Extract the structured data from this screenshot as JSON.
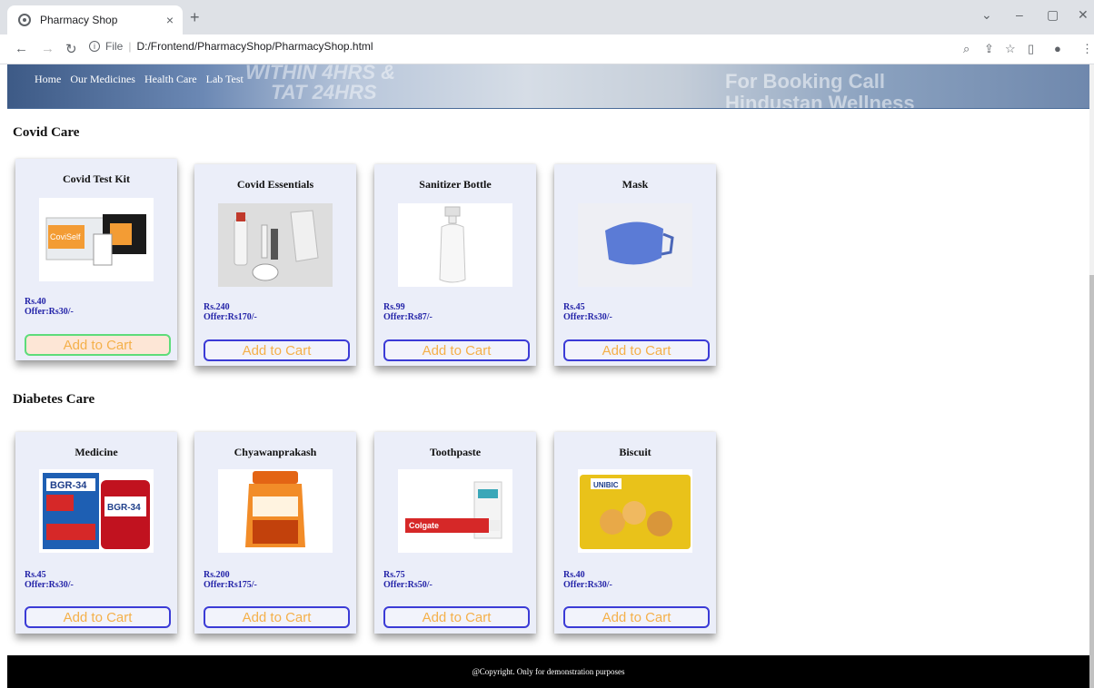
{
  "browser": {
    "tab_title": "Pharmacy Shop",
    "tab_close": "×",
    "new_tab": "+",
    "url_file_label": "File",
    "url_separator": "|",
    "url_path": "D:/Frontend/PharmacyShop/PharmacyShop.html",
    "min": "–",
    "max": "▢",
    "close": "✕",
    "chevron": "⌄"
  },
  "banner": {
    "bg_text_1": "WITHIN 4HRS &",
    "bg_text_2": "TAT 24HRS",
    "bg_text_3": "For Booking Call",
    "bg_text_4": "Hindustan Wellness",
    "nav": [
      "Home",
      "Our Medicines",
      "Health Care",
      "Lab Test"
    ]
  },
  "sections": [
    {
      "title": "Covid Care",
      "products": [
        {
          "name": "Covid Test Kit",
          "price": "Rs.40",
          "offer": "Offer:Rs30/-",
          "button": "Add to Cart",
          "icon": "test-kit-icon"
        },
        {
          "name": "Covid Essentials",
          "price": "Rs.240",
          "offer": "Offer:Rs170/-",
          "button": "Add to Cart",
          "icon": "essentials-icon"
        },
        {
          "name": "Sanitizer Bottle",
          "price": "Rs.99",
          "offer": "Offer:Rs87/-",
          "button": "Add to Cart",
          "icon": "sanitizer-icon"
        },
        {
          "name": "Mask",
          "price": "Rs.45",
          "offer": "Offer:Rs30/-",
          "button": "Add to Cart",
          "icon": "mask-icon"
        }
      ]
    },
    {
      "title": "Diabetes Care",
      "products": [
        {
          "name": "Medicine",
          "price": "Rs.45",
          "offer": "Offer:Rs30/-",
          "button": "Add to Cart",
          "icon": "medicine-icon"
        },
        {
          "name": "Chyawanprakash",
          "price": "Rs.200",
          "offer": "Offer:Rs175/-",
          "button": "Add to Cart",
          "icon": "jar-icon"
        },
        {
          "name": "Toothpaste",
          "price": "Rs.75",
          "offer": "Offer:Rs50/-",
          "button": "Add to Cart",
          "icon": "toothpaste-icon"
        },
        {
          "name": "Biscuit",
          "price": "Rs.40",
          "offer": "Offer:Rs30/-",
          "button": "Add to Cart",
          "icon": "biscuit-icon"
        }
      ]
    }
  ],
  "product_image_text": {
    "test_kit": "CoviSelf",
    "medicine_1": "BGR-34",
    "medicine_2": "BGR-34",
    "toothpaste": "Colgate",
    "biscuit": "UNIBIC"
  },
  "footer": {
    "text": "@Copyright. Only for demonstration purposes"
  },
  "colors": {
    "accent": "#3b3bd6",
    "button_text": "#f4b04a",
    "card_bg": "#ebeef9",
    "price": "#2323a8"
  }
}
